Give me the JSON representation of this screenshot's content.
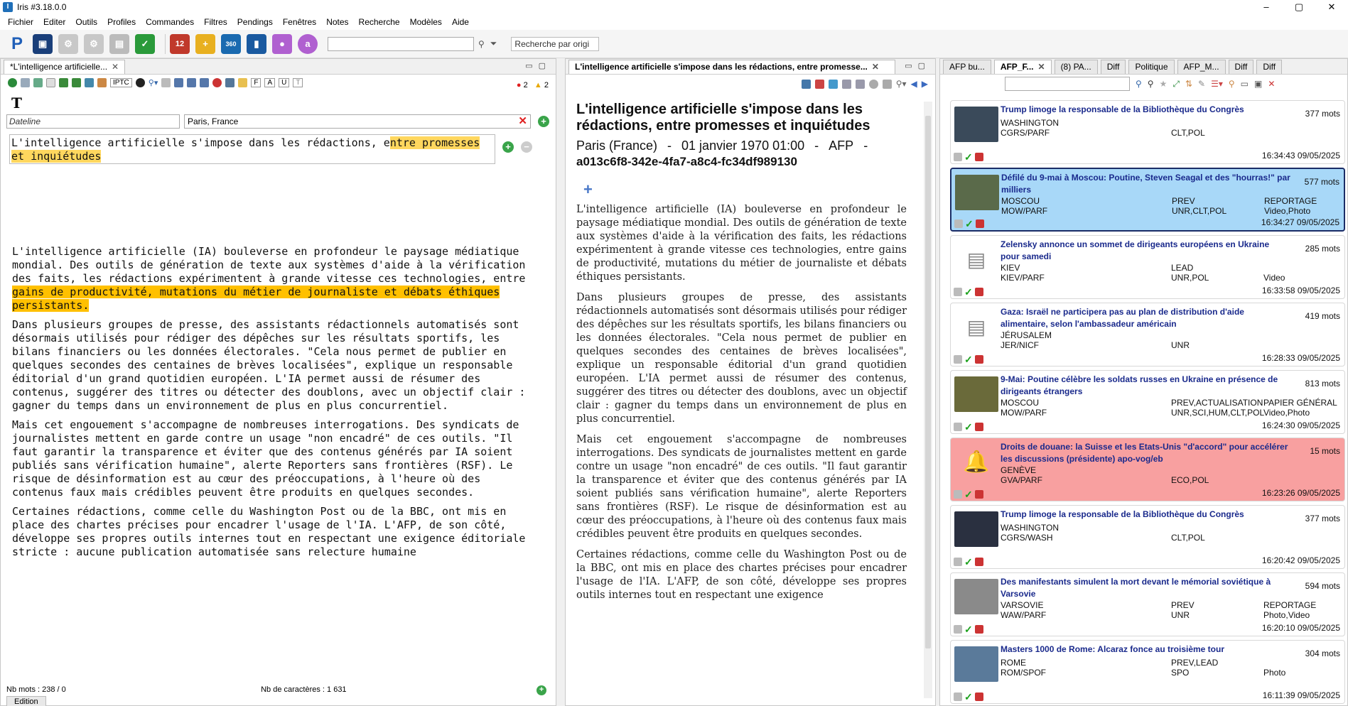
{
  "window": {
    "title": "Iris #3.18.0.0",
    "controls": [
      "–",
      "▢",
      "✕"
    ]
  },
  "menu": [
    "Fichier",
    "Editer",
    "Outils",
    "Profiles",
    "Commandes",
    "Filtres",
    "Pendings",
    "Fenêtres",
    "Notes",
    "Recherche",
    "Modèles",
    "Aide"
  ],
  "toolbar": {
    "search_placeholder": "",
    "search_orig": "Recherche par origi",
    "calendar_day": "12"
  },
  "editor": {
    "tab": "*L'intelligence artificielle...",
    "iptc": "IPTC",
    "fields": [
      "F",
      "A",
      "U",
      "T"
    ],
    "alerts_red": "2",
    "alerts_yellow": "2",
    "big_t": "T",
    "dateline_label": "Dateline",
    "dateline_value": "Paris, France",
    "headline_pre": "L'intelligence artificielle s'impose dans les rédactions, e",
    "headline_hl": "ntre promesses et inquiétudes",
    "p1_pre": "L'intelligence artificielle (IA) bouleverse en profondeur le paysage médiatique mondial. Des outils de génération de texte aux systèmes d'aide à la vérification des faits, les rédactions expérimentent à grande vitesse ces technologies, entre ",
    "p1_hl": "gains de productivité, mutations du métier de journaliste et débats éthiques persistants.",
    "p2": "Dans plusieurs groupes de presse, des assistants rédactionnels automatisés sont désormais utilisés pour rédiger des dépêches sur les résultats sportifs, les bilans financiers ou les données électorales. \"Cela nous permet de publier en quelques secondes des centaines de brèves localisées\", explique un responsable éditorial d'un grand quotidien européen. L'IA permet aussi de résumer des contenus, suggérer des titres ou détecter des doublons, avec un objectif clair : gagner du temps dans un environnement de plus en plus concurrentiel.",
    "p3": "Mais cet engouement s'accompagne de nombreuses interrogations. Des syndicats de journalistes mettent en garde contre un usage \"non encadré\" de ces outils. \"Il faut garantir la transparence et éviter que des contenus générés par IA soient publiés sans vérification humaine\", alerte Reporters sans frontières (RSF). Le risque de désinformation est au cœur des préoccupations, à l'heure où des contenus faux mais crédibles peuvent être produits en quelques secondes.",
    "p4": "Certaines rédactions, comme celle du Washington Post ou de la BBC, ont mis en place des chartes précises pour encadrer l'usage de l'IA. L'AFP, de son côté, développe ses propres outils internes tout en respectant une exigence éditoriale stricte : aucune publication automatisée sans relecture humaine",
    "word_count": "Nb mots : 238 / 0",
    "char_count": "Nb de caractères : 1 631",
    "bottom_tab": "Edition"
  },
  "preview": {
    "tab": "L'intelligence artificielle s'impose dans les rédactions, entre promesse...",
    "title": "L'intelligence artificielle s'impose dans les rédactions, entre promesses et inquiétudes",
    "place": "Paris (France)",
    "date": "01 janvier 1970 01:00",
    "agency": "AFP",
    "id": "a013c6f8-342e-4fa7-a8c4-fc34df989130",
    "plus": "+",
    "p1": "L'intelligence artificielle (IA) bouleverse en profondeur le paysage médiatique mondial. Des outils de génération de texte aux systèmes d'aide à la vérification des faits, les rédactions expérimentent à grande vitesse ces technologies, entre gains de productivité, mutations du métier de journaliste et débats éthiques persistants.",
    "p2": "Dans plusieurs groupes de presse, des assistants rédactionnels automatisés sont désormais utilisés pour rédiger des dépêches sur les résultats sportifs, les bilans financiers ou les données électorales. \"Cela nous permet de publier en quelques secondes des centaines de brèves localisées\", explique un responsable éditorial d'un grand quotidien européen. L'IA permet aussi de résumer des contenus, suggérer des titres ou détecter des doublons, avec un objectif clair : gagner du temps dans un environnement de plus en plus concurrentiel.",
    "p3": "Mais cet engouement s'accompagne de nombreuses interrogations. Des syndicats de journalistes mettent en garde contre un usage \"non encadré\" de ces outils. \"Il faut garantir la transparence et éviter que des contenus générés par IA soient publiés sans vérification humaine\", alerte Reporters sans frontières (RSF). Le risque de désinformation est au cœur des préoccupations, à l'heure où des contenus faux mais crédibles peuvent être produits en quelques secondes.",
    "p4": "Certaines rédactions, comme celle du Washington Post ou de la BBC, ont mis en place des chartes précises pour encadrer l'usage de l'IA. L'AFP, de son côté, développe ses propres outils internes tout en respectant une exigence"
  },
  "right_tabs": [
    "AFP bu...",
    "AFP_F...",
    "(8) PA...",
    "Diff",
    "Politique",
    "AFP_M...",
    "Diff",
    "Diff"
  ],
  "news": [
    {
      "title": "Trump limoge la responsable de la Bibliothèque du Congrès",
      "words": "377 mots",
      "r1": [
        "WASHINGTON",
        "",
        ""
      ],
      "r2": [
        "CGRS/PARF",
        "CLT,POL",
        ""
      ],
      "time": "16:34:43  09/05/2025",
      "style": "normal",
      "thumb": "#3a4a5a"
    },
    {
      "title": "Défilé du 9-mai à Moscou: Poutine, Steven Seagal et des \"hourras!\" par milliers",
      "words": "577 mots",
      "r1": [
        "MOSCOU",
        "PREV",
        "REPORTAGE"
      ],
      "r2": [
        "MOW/PARF",
        "UNR,CLT,POL",
        "Video,Photo"
      ],
      "time": "16:34:27  09/05/2025",
      "style": "sel",
      "thumb": "#5a6a4a"
    },
    {
      "title": "Zelensky annonce un sommet de dirigeants européens en Ukraine pour samedi",
      "words": "285 mots",
      "r1": [
        "KIEV",
        "LEAD",
        ""
      ],
      "r2": [
        "KIEV/PARF",
        "UNR,POL",
        "Video"
      ],
      "time": "16:33:58  09/05/2025",
      "style": "normal",
      "thumb": "doc"
    },
    {
      "title": "Gaza: Israël ne participera pas au plan de distribution d'aide alimentaire, selon l'ambassadeur américain",
      "words": "419 mots",
      "r1": [
        "JÉRUSALEM",
        "",
        ""
      ],
      "r2": [
        "JER/NICF",
        "UNR",
        ""
      ],
      "time": "16:28:33  09/05/2025",
      "style": "normal",
      "thumb": "doc"
    },
    {
      "title": "9-Mai: Poutine célèbre les soldats russes en Ukraine en présence de dirigeants étrangers",
      "words": "813 mots",
      "r1": [
        "MOSCOU",
        "PREV,ACTUALISATION",
        "PAPIER GÉNÉRAL"
      ],
      "r2": [
        "MOW/PARF",
        "UNR,SCI,HUM,CLT,POL",
        "Video,Photo"
      ],
      "time": "16:24:30  09/05/2025",
      "style": "normal",
      "thumb": "#6a6a3a"
    },
    {
      "title": "Droits de douane: la Suisse et les Etats-Unis \"d'accord\" pour accélérer les discussions (présidente) apo-vog/eb",
      "words": "15 mots",
      "r1": [
        "GENÈVE",
        "",
        ""
      ],
      "r2": [
        "GVA/PARF",
        "ECO,POL",
        ""
      ],
      "time": "16:23:26  09/05/2025",
      "style": "alert",
      "thumb": "bell"
    },
    {
      "title": "Trump limoge la responsable de la Bibliothèque du Congrès",
      "words": "377 mots",
      "r1": [
        "WASHINGTON",
        "",
        ""
      ],
      "r2": [
        "CGRS/WASH",
        "CLT,POL",
        ""
      ],
      "time": "16:20:42  09/05/2025",
      "style": "normal",
      "thumb": "#2a3040"
    },
    {
      "title": "Des manifestants simulent la mort devant le mémorial soviétique à Varsovie",
      "words": "594 mots",
      "r1": [
        "VARSOVIE",
        "PREV",
        "REPORTAGE"
      ],
      "r2": [
        "WAW/PARF",
        "UNR",
        "Photo,Video"
      ],
      "time": "16:20:10  09/05/2025",
      "style": "normal",
      "thumb": "#8a8a8a"
    },
    {
      "title": "Masters 1000 de Rome: Alcaraz fonce au troisième tour",
      "words": "304 mots",
      "r1": [
        "ROME",
        "PREV,LEAD",
        ""
      ],
      "r2": [
        "ROM/SPOF",
        "SPO",
        "Photo"
      ],
      "time": "16:11:39  09/05/2025",
      "style": "normal",
      "thumb": "#5a7a9a"
    }
  ]
}
